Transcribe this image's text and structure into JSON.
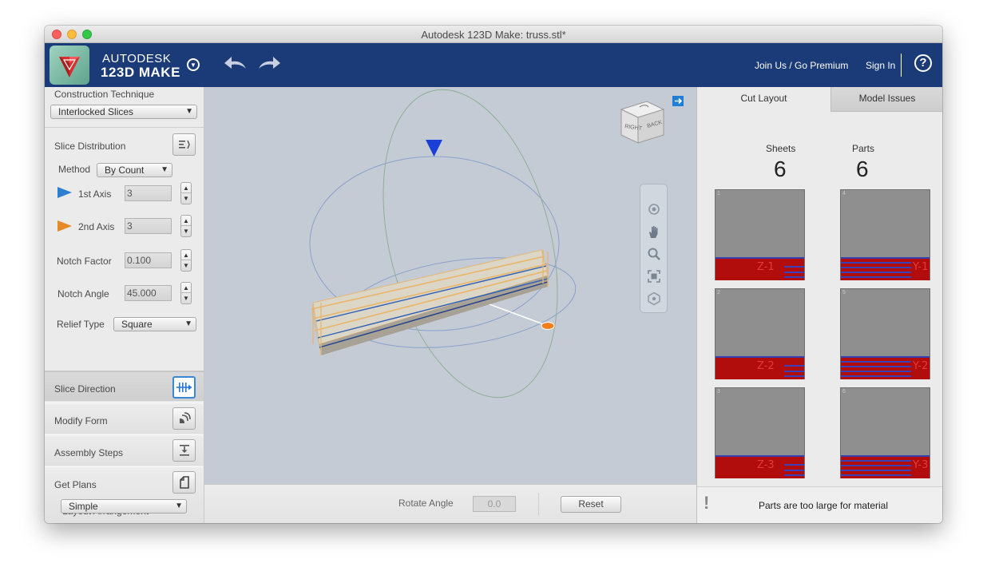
{
  "window": {
    "title": "Autodesk 123D Make: truss.stl*"
  },
  "header": {
    "brand_line1": "AUTODESK",
    "brand_line2": "123D MAKE",
    "join_link": "Join Us / Go Premium",
    "signin_link": "Sign In",
    "help_symbol": "?"
  },
  "left_panel": {
    "construction_technique_label": "Construction Technique",
    "construction_technique_value": "Interlocked Slices",
    "slice_distribution_label": "Slice Distribution",
    "method_label": "Method",
    "method_value": "By Count",
    "axis1_label": "1st Axis",
    "axis1_value": "3",
    "axis2_label": "2nd Axis",
    "axis2_value": "3",
    "notch_factor_label": "Notch Factor",
    "notch_factor_value": "0.100",
    "notch_angle_label": "Notch Angle",
    "notch_angle_value": "45.000",
    "relief_type_label": "Relief Type",
    "relief_type_value": "Square",
    "sections": [
      {
        "label": "Slice Direction",
        "icon": "slice-direction-icon"
      },
      {
        "label": "Modify Form",
        "icon": "modify-form-icon"
      },
      {
        "label": "Assembly Steps",
        "icon": "assembly-steps-icon"
      },
      {
        "label": "Get Plans",
        "icon": "get-plans-icon"
      }
    ],
    "layout_arrangement_label": "Layout Arrangement",
    "layout_arrangement_value": "Simple"
  },
  "viewport": {
    "viewcube_right": "RIGHT",
    "viewcube_back": "BACK",
    "rotate_angle_label": "Rotate Angle",
    "rotate_angle_value": "0.0",
    "reset_label": "Reset"
  },
  "right_panel": {
    "tabs": [
      "Cut Layout",
      "Model Issues"
    ],
    "sheets_label": "Sheets",
    "sheets_value": "6",
    "parts_label": "Parts",
    "parts_value": "6",
    "sheets": [
      {
        "number": "1",
        "tag": "Z-1"
      },
      {
        "number": "4",
        "tag": "Y-1"
      },
      {
        "number": "2",
        "tag": "Z-2"
      },
      {
        "number": "5",
        "tag": "Y-2"
      },
      {
        "number": "3",
        "tag": "Z-3"
      },
      {
        "number": "6",
        "tag": "Y-3"
      }
    ],
    "warning_icon": "exclamation-icon",
    "warning_text": "Parts are too large for material"
  },
  "colors": {
    "header_bg": "#1b3a78",
    "slice_red": "#b10d0d",
    "slice_blue_line": "#3b3fb8",
    "active_blue": "#3a86d8",
    "axis1_color": "#2f7fd0",
    "axis2_color": "#e58a24"
  }
}
